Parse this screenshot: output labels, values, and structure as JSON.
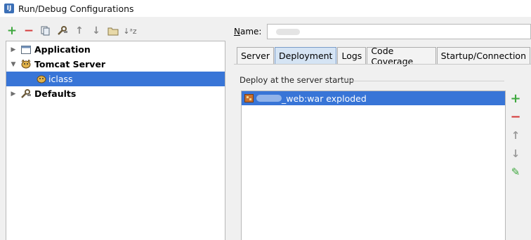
{
  "window": {
    "title": "Run/Debug Configurations",
    "logo_text": "IJ"
  },
  "toolbar": {
    "add": "+",
    "remove": "−",
    "copy": "⧉",
    "edit_defaults": "🔧",
    "move_up": "↑",
    "move_down": "↓",
    "folder": "📁",
    "sort": "↓ᵃz"
  },
  "tree": {
    "items": [
      {
        "label": "Application",
        "arrow": "▶"
      },
      {
        "label": "Tomcat Server",
        "arrow": "▼"
      },
      {
        "label": "iclass"
      },
      {
        "label": "Defaults",
        "arrow": "▶"
      }
    ]
  },
  "name_field": {
    "label": "Name:",
    "mnemonic": "N",
    "rest": "ame:"
  },
  "tabs": [
    {
      "label": "Server"
    },
    {
      "label": "Deployment"
    },
    {
      "label": "Logs"
    },
    {
      "label": "Code Coverage"
    },
    {
      "label": "Startup/Connection"
    }
  ],
  "deployment": {
    "caption": "Deploy at the server startup",
    "artifacts": [
      {
        "label": "_web:war exploded"
      }
    ],
    "buttons": {
      "add": "+",
      "remove": "−",
      "up": "↑",
      "down": "↓",
      "edit": "✎"
    }
  },
  "colors": {
    "selection": "#3875d7",
    "add": "#3ea83e",
    "remove": "#d53b3b",
    "tab_active": "#d5e4f4"
  }
}
